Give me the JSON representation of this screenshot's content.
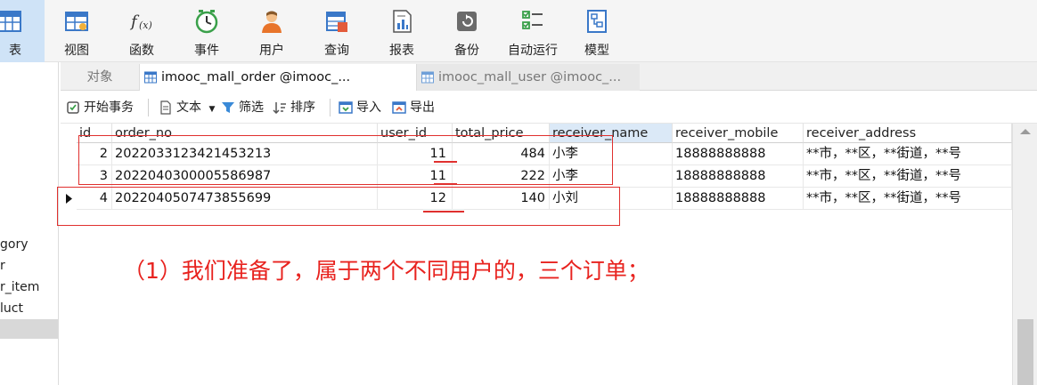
{
  "toolbar": {
    "items": [
      {
        "label": "表",
        "icon": "table-icon"
      },
      {
        "label": "视图",
        "icon": "view-icon"
      },
      {
        "label": "函数",
        "icon": "function-icon"
      },
      {
        "label": "事件",
        "icon": "clock-icon"
      },
      {
        "label": "用户",
        "icon": "user-icon"
      },
      {
        "label": "查询",
        "icon": "query-icon"
      },
      {
        "label": "报表",
        "icon": "report-icon"
      },
      {
        "label": "备份",
        "icon": "backup-icon"
      },
      {
        "label": "自动运行",
        "icon": "autorun-icon"
      },
      {
        "label": "模型",
        "icon": "model-icon"
      }
    ]
  },
  "sidebar": {
    "items": [
      "gory",
      "r",
      "r_item",
      "luct",
      ""
    ]
  },
  "tabs": {
    "objects": "对象",
    "active": "imooc_mall_order @imooc_...",
    "inactive": "imooc_mall_user @imooc_..."
  },
  "subtoolbar": {
    "begin_transaction": "开始事务",
    "text": "文本",
    "filter": "筛选",
    "sort": "排序",
    "import": "导入",
    "export": "导出"
  },
  "grid": {
    "columns": [
      "id",
      "order_no",
      "user_id",
      "total_price",
      "receiver_name",
      "receiver_mobile",
      "receiver_address"
    ],
    "rows": [
      [
        "2",
        "2022033123421453213",
        "11",
        "484",
        "小李",
        "18888888888",
        "**市，**区，**街道，**号"
      ],
      [
        "3",
        "2022040300005586987",
        "11",
        "222",
        "小李",
        "18888888888",
        "**市，**区，**街道，**号"
      ],
      [
        "4",
        "2022040507473855699",
        "12",
        "140",
        "小刘",
        "18888888888",
        "**市，**区，**街道，**号"
      ]
    ],
    "current_row": 3
  },
  "annotation": {
    "text": "（1）我们准备了，属于两个不同用户的，三个订单；",
    "color": "#e8231f"
  }
}
